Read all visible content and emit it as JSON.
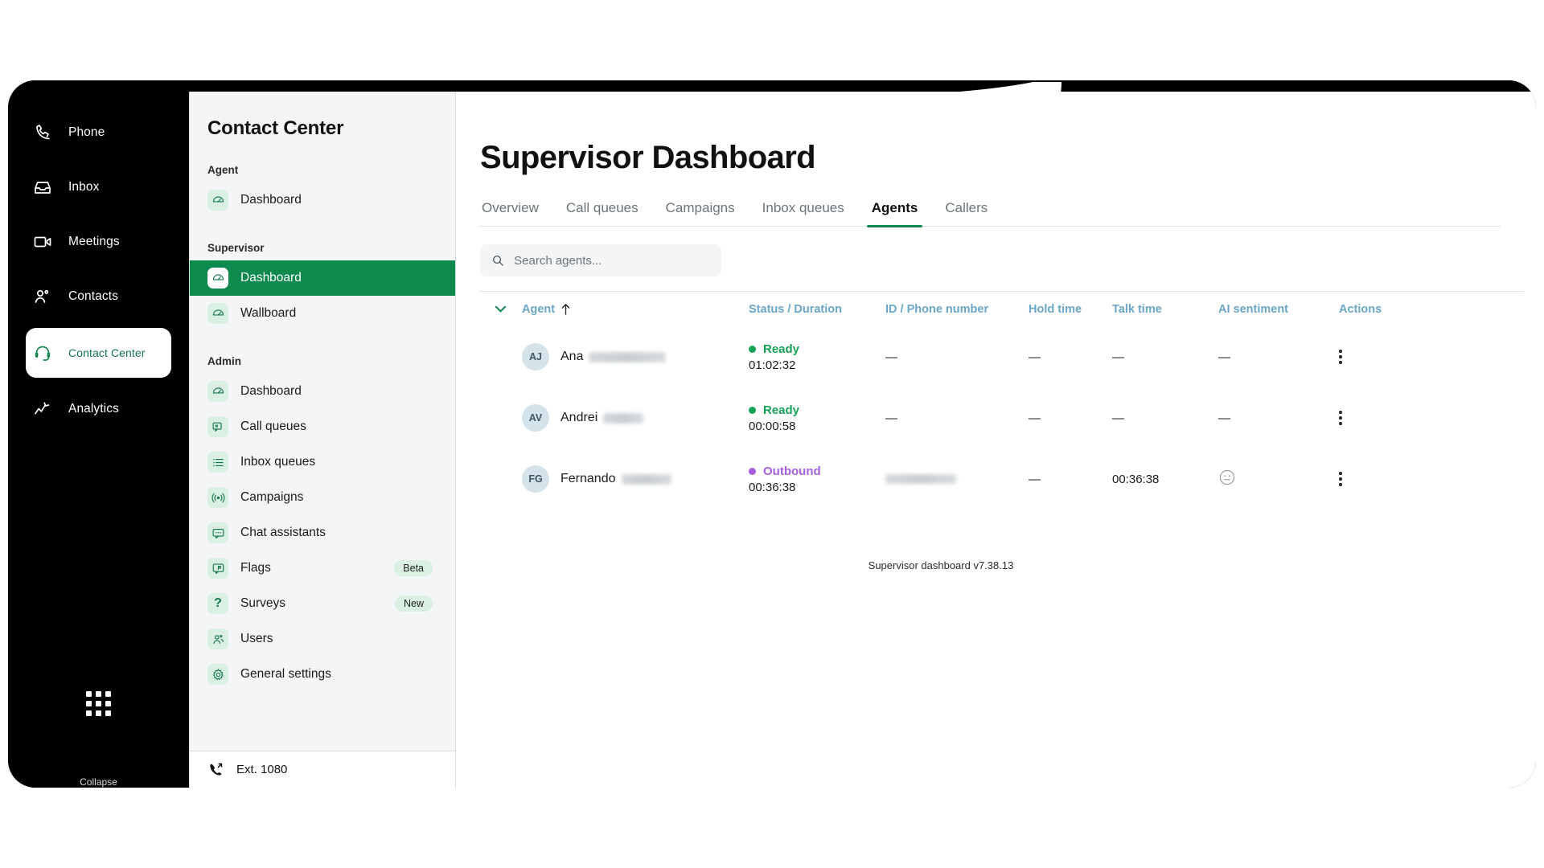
{
  "rail": {
    "items": [
      {
        "label": "Phone",
        "icon": "phone-icon",
        "active": false
      },
      {
        "label": "Inbox",
        "icon": "inbox-icon",
        "active": false
      },
      {
        "label": "Meetings",
        "icon": "video-camera-icon",
        "active": false
      },
      {
        "label": "Contacts",
        "icon": "contacts-icon",
        "active": false
      },
      {
        "label": "Contact Center",
        "icon": "headset-icon",
        "active": true
      },
      {
        "label": "Analytics",
        "icon": "analytics-icon",
        "active": false
      }
    ],
    "apps_icon": "apps-grid-icon",
    "bottom_label": "Collapse"
  },
  "subnav": {
    "title": "Contact Center",
    "groups": [
      {
        "label": "Agent",
        "items": [
          {
            "label": "Dashboard",
            "icon": "gauge-icon",
            "selected": false,
            "badge": ""
          }
        ]
      },
      {
        "label": "Supervisor",
        "items": [
          {
            "label": "Dashboard",
            "icon": "gauge-icon",
            "selected": true,
            "badge": ""
          },
          {
            "label": "Wallboard",
            "icon": "gauge-icon",
            "selected": false,
            "badge": ""
          }
        ]
      },
      {
        "label": "Admin",
        "items": [
          {
            "label": "Dashboard",
            "icon": "gauge-icon",
            "selected": false,
            "badge": ""
          },
          {
            "label": "Call queues",
            "icon": "call-queue-icon",
            "selected": false,
            "badge": ""
          },
          {
            "label": "Inbox queues",
            "icon": "list-icon",
            "selected": false,
            "badge": ""
          },
          {
            "label": "Campaigns",
            "icon": "broadcast-icon",
            "selected": false,
            "badge": ""
          },
          {
            "label": "Chat assistants",
            "icon": "chat-icon",
            "selected": false,
            "badge": ""
          },
          {
            "label": "Flags",
            "icon": "flag-chat-icon",
            "selected": false,
            "badge": "Beta"
          },
          {
            "label": "Surveys",
            "icon": "question-icon",
            "selected": false,
            "badge": "New"
          },
          {
            "label": "Users",
            "icon": "users-icon",
            "selected": false,
            "badge": ""
          },
          {
            "label": "General settings",
            "icon": "gear-icon",
            "selected": false,
            "badge": ""
          }
        ]
      }
    ],
    "footer": {
      "icon": "phone-forward-icon",
      "label": "Ext. 1080"
    }
  },
  "main": {
    "page_title": "Supervisor Dashboard",
    "tabs": [
      {
        "label": "Overview",
        "active": false
      },
      {
        "label": "Call queues",
        "active": false
      },
      {
        "label": "Campaigns",
        "active": false
      },
      {
        "label": "Inbox queues",
        "active": false
      },
      {
        "label": "Agents",
        "active": true
      },
      {
        "label": "Callers",
        "active": false
      }
    ],
    "search": {
      "placeholder": "Search agents...",
      "value": "",
      "icon": "search-icon"
    },
    "table": {
      "sort_caret_icon": "caret-down-icon",
      "sort_arrow_icon": "arrow-up-icon",
      "columns": [
        "Agent",
        "Status / Duration",
        "ID / Phone number",
        "Hold time",
        "Talk time",
        "AI sentiment",
        "Actions"
      ],
      "rows": [
        {
          "initials": "AJ",
          "name": "Ana",
          "name_redacted": true,
          "redact_width": 96,
          "status": "Ready",
          "status_color": "#17a357",
          "duration": "01:02:32",
          "id_phone": "—",
          "id_redacted": false,
          "hold_time": "—",
          "talk_time": "—",
          "ai_sentiment": "—",
          "sentiment_icon": "",
          "actions_icon": "kebab-menu-icon"
        },
        {
          "initials": "AV",
          "name": "Andrei",
          "name_redacted": true,
          "redact_width": 50,
          "status": "Ready",
          "status_color": "#17a357",
          "duration": "00:00:58",
          "id_phone": "—",
          "id_redacted": false,
          "hold_time": "—",
          "talk_time": "—",
          "ai_sentiment": "—",
          "sentiment_icon": "",
          "actions_icon": "kebab-menu-icon"
        },
        {
          "initials": "FG",
          "name": "Fernando",
          "name_redacted": true,
          "redact_width": 62,
          "status": "Outbound",
          "status_color": "#a65fe0",
          "duration": "00:36:38",
          "id_phone": "",
          "id_redacted": true,
          "hold_time": "—",
          "talk_time": "00:36:38",
          "ai_sentiment": "",
          "sentiment_icon": "neutral-face-icon",
          "actions_icon": "kebab-menu-icon"
        }
      ]
    },
    "footer_version": "Supervisor dashboard v7.38.13"
  },
  "colors": {
    "brand_green": "#0e8a4f",
    "accent_green_light": "#d9f0e3",
    "header_blue": "#6aa6c8",
    "status_ready": "#17a357",
    "status_outbound": "#a65fe0"
  }
}
